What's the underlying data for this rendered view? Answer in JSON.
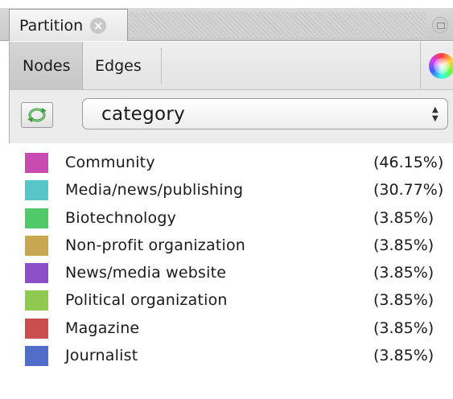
{
  "panel": {
    "tab_title": "Partition",
    "close_glyph": "×"
  },
  "toolbar": {
    "nodes_label": "Nodes",
    "edges_label": "Edges",
    "palette_icon": "color-wheel-icon"
  },
  "selector": {
    "refresh_icon": "refresh-icon",
    "selected_value": "category",
    "arrow_up": "▲",
    "arrow_down": "▼"
  },
  "partitions": [
    {
      "label": "Community",
      "percent": "(46.15%)",
      "color": "#c94ab0"
    },
    {
      "label": "Media/news/publishing",
      "percent": "(30.77%)",
      "color": "#56c6c9"
    },
    {
      "label": "Biotechnology",
      "percent": "(3.85%)",
      "color": "#4fc96a"
    },
    {
      "label": "Non-profit organization",
      "percent": "(3.85%)",
      "color": "#c8a84f"
    },
    {
      "label": "News/media website",
      "percent": "(3.85%)",
      "color": "#8d4fc9"
    },
    {
      "label": "Political organization",
      "percent": "(3.85%)",
      "color": "#8fc94f"
    },
    {
      "label": "Magazine",
      "percent": "(3.85%)",
      "color": "#c94f4f"
    },
    {
      "label": "Journalist",
      "percent": "(3.85%)",
      "color": "#4f6ec9"
    }
  ]
}
